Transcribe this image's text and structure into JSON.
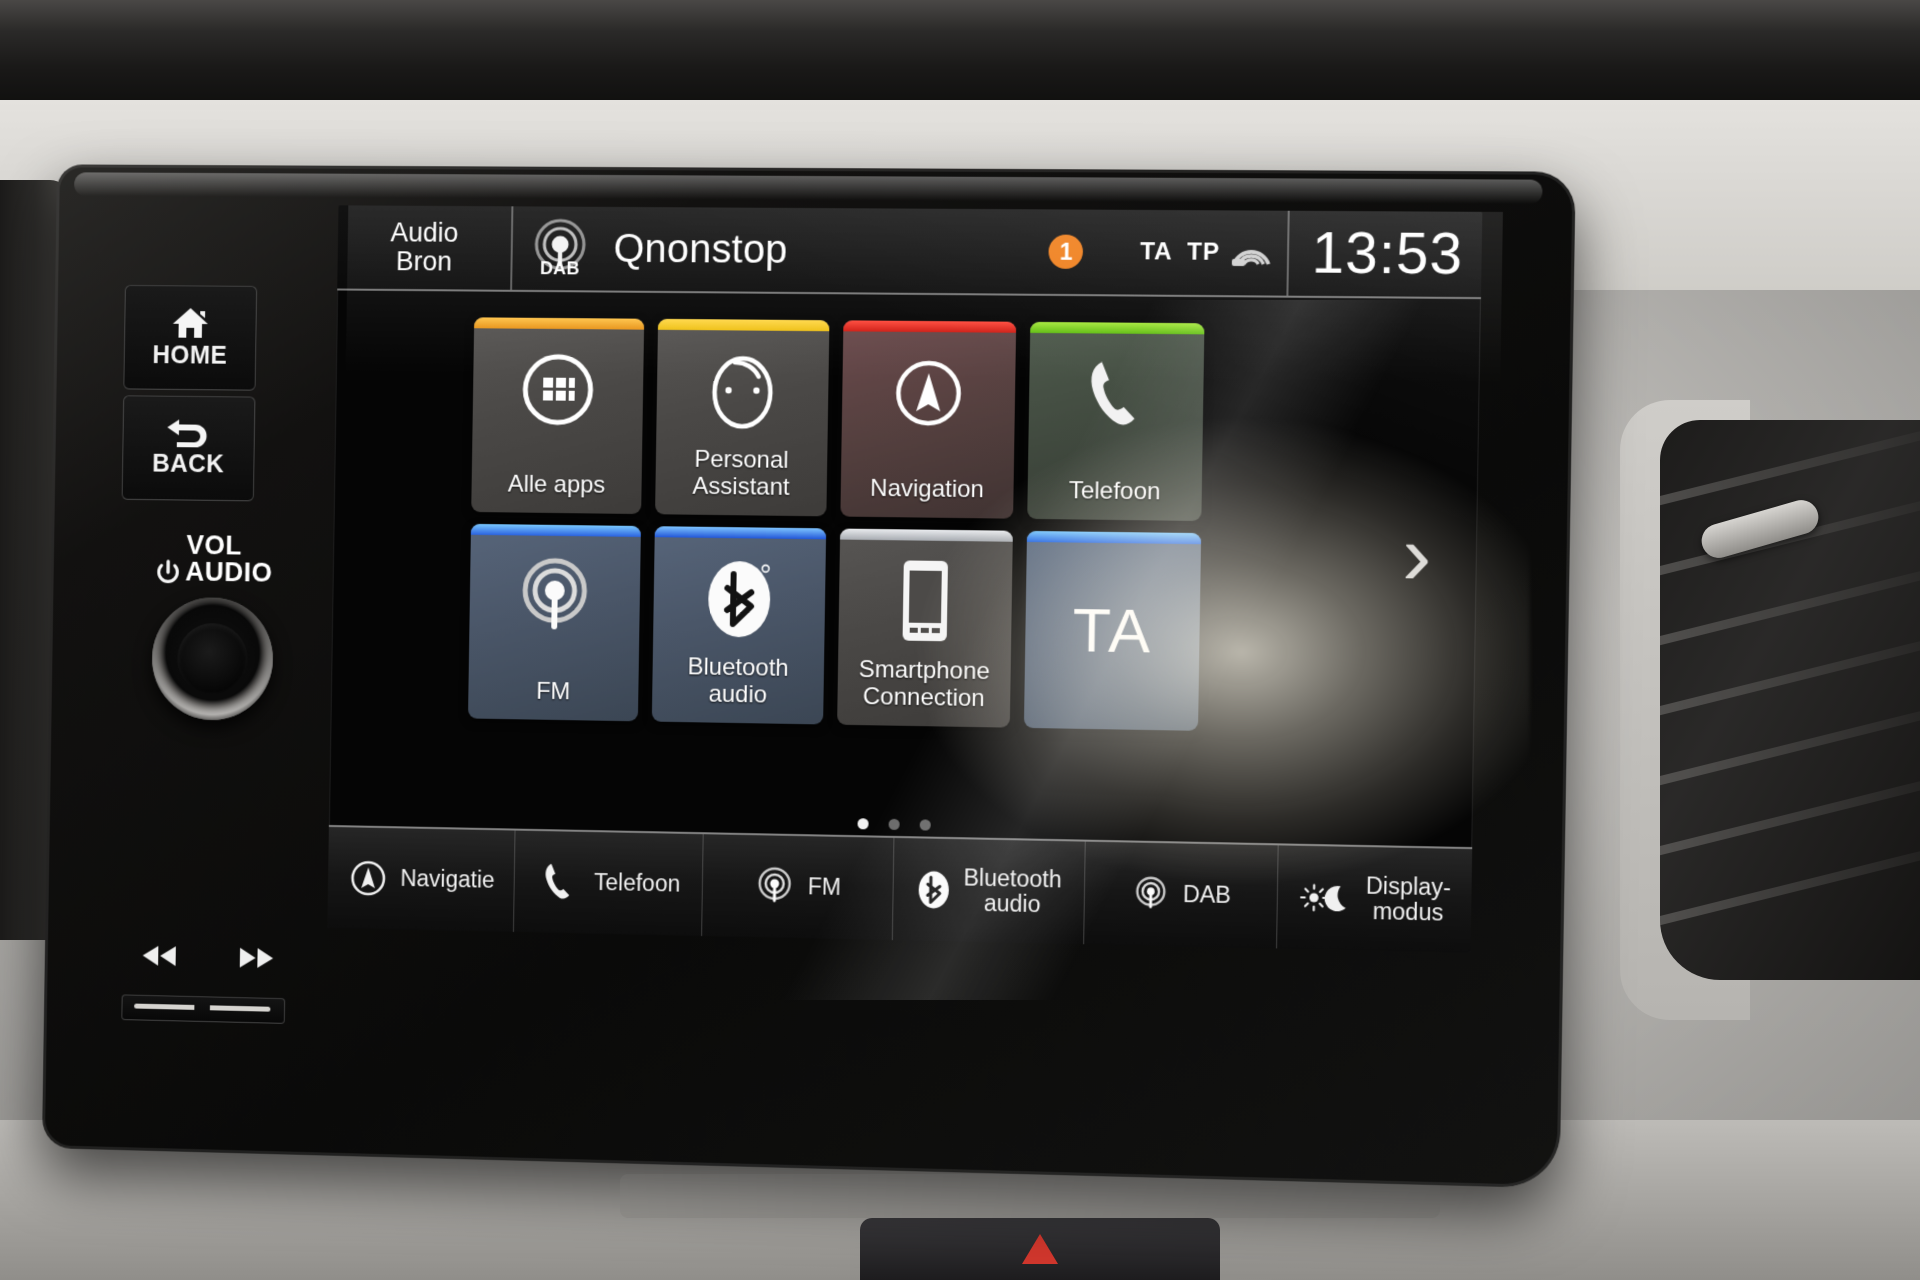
{
  "statusbar": {
    "source_line1": "Audio",
    "source_line2": "Bron",
    "band_icon_label": "DAB",
    "station_title": "Qnonstop",
    "notification_count": "1",
    "ta_label": "TA",
    "tp_label": "TP",
    "signal_icon": "signal-strength-icon",
    "time": "13:53"
  },
  "tiles": [
    {
      "label": "Alle apps",
      "icon": "grid-apps-icon",
      "cap_color": "#f0a81c",
      "style": ""
    },
    {
      "label": "Personal\nAssistant",
      "icon": "personal-assistant-icon",
      "cap_color": "#f2c316",
      "style": ""
    },
    {
      "label": "Navigation",
      "icon": "navigation-compass-icon",
      "cap_color": "#e02a20",
      "style": "nav"
    },
    {
      "label": "Telefoon",
      "icon": "phone-handset-icon",
      "cap_color": "#7dd321",
      "style": "tel"
    },
    {
      "label": "FM",
      "icon": "radio-waves-icon",
      "cap_color": "#3c7ff0",
      "style": "blue"
    },
    {
      "label": "Bluetooth\naudio",
      "icon": "bluetooth-icon",
      "cap_color": "#2f6fe8",
      "style": "blue"
    },
    {
      "label": "Smartphone\nConnection",
      "icon": "smartphone-icon",
      "cap_color": "#cfd2d6",
      "style": ""
    },
    {
      "label": "TA",
      "icon": "ta-text",
      "cap_color": "#2e7ff2",
      "style": "ta"
    }
  ],
  "pagination": {
    "total": 3,
    "active_index": 0
  },
  "next_page_chevron": "›",
  "dock": [
    {
      "label": "Navigatie",
      "icon": "navigation-compass-icon"
    },
    {
      "label": "Telefoon",
      "icon": "phone-handset-icon"
    },
    {
      "label": "FM",
      "icon": "radio-waves-icon"
    },
    {
      "label": "Bluetooth\naudio",
      "icon": "bluetooth-icon"
    },
    {
      "label": "DAB",
      "icon": "radio-waves-icon"
    },
    {
      "label": "Display-\nmodus",
      "icon": "brightness-moon-icon"
    }
  ],
  "hardware": {
    "home_label": "HOME",
    "home_icon": "house-icon",
    "back_label": "BACK",
    "back_icon": "u-turn-arrow-icon",
    "vol_label_line1": "VOL",
    "vol_label_line2": "AUDIO",
    "power_icon": "power-icon",
    "prev_track_icon": "previous-track-icon",
    "next_track_icon": "next-track-icon"
  },
  "colors": {
    "accent_orange": "#f07d18",
    "screen_bg": "#050505",
    "tile_bg": "#4a4846",
    "text": "#ffffff"
  }
}
